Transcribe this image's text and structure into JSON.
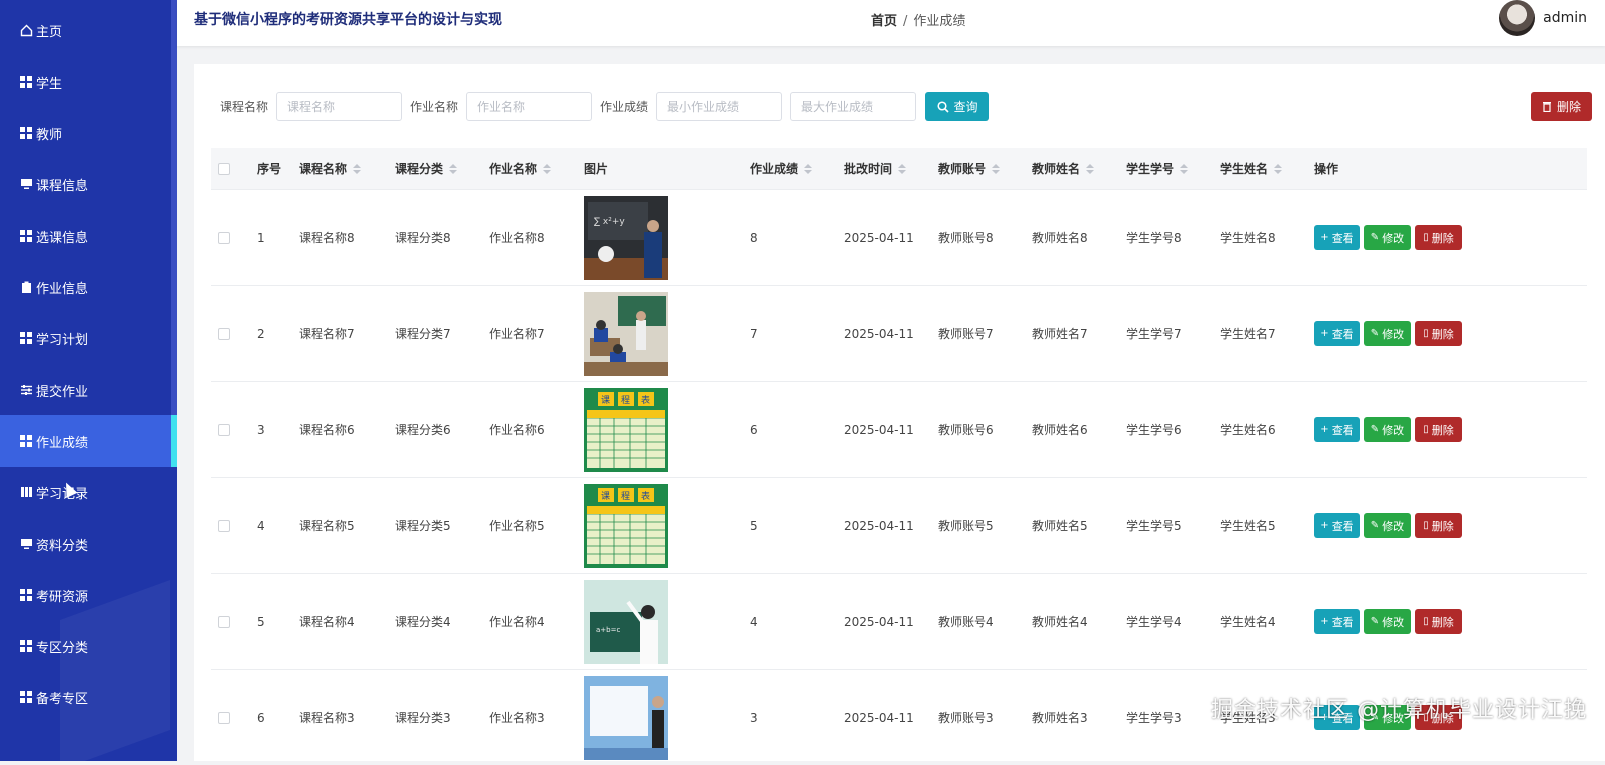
{
  "header": {
    "site_title": "基于微信小程序的考研资源共享平台的设计与实现",
    "breadcrumb_home": "首页",
    "breadcrumb_sep": "/",
    "breadcrumb_current": "作业成绩",
    "username": "admin"
  },
  "sidebar": {
    "items": [
      {
        "label": "主页",
        "icon": "home-icon"
      },
      {
        "label": "学生",
        "icon": "grid-icon"
      },
      {
        "label": "教师",
        "icon": "grid-icon"
      },
      {
        "label": "课程信息",
        "icon": "monitor-icon"
      },
      {
        "label": "选课信息",
        "icon": "grid-icon"
      },
      {
        "label": "作业信息",
        "icon": "clipboard-icon"
      },
      {
        "label": "学习计划",
        "icon": "grid-icon"
      },
      {
        "label": "提交作业",
        "icon": "sliders-icon"
      },
      {
        "label": "作业成绩",
        "icon": "grid-icon",
        "active": true
      },
      {
        "label": "学习记录",
        "icon": "columns-icon"
      },
      {
        "label": "资料分类",
        "icon": "monitor-icon"
      },
      {
        "label": "考研资源",
        "icon": "grid-icon"
      },
      {
        "label": "专区分类",
        "icon": "grid-icon"
      },
      {
        "label": "备考专区",
        "icon": "grid-icon"
      }
    ]
  },
  "search": {
    "course_label": "课程名称",
    "course_placeholder": "课程名称",
    "homework_label": "作业名称",
    "homework_placeholder": "作业名称",
    "score_label": "作业成绩",
    "min_placeholder": "最小作业成绩",
    "max_placeholder": "最大作业成绩",
    "query_label": "查询",
    "delete_label": "删除"
  },
  "table": {
    "columns": [
      "序号",
      "课程名称",
      "课程分类",
      "作业名称",
      "图片",
      "作业成绩",
      "批改时间",
      "教师账号",
      "教师姓名",
      "学生学号",
      "学生姓名",
      "操作"
    ],
    "rows": [
      {
        "idx": "1",
        "course": "课程名称8",
        "category": "课程分类8",
        "homework": "作业名称8",
        "image": "classroom-chalkboard",
        "score": "8",
        "time": "2025-04-11",
        "teacher_no": "教师账号8",
        "teacher_name": "教师姓名8",
        "student_no": "学生学号8",
        "student_name": "学生姓名8"
      },
      {
        "idx": "2",
        "course": "课程名称7",
        "category": "课程分类7",
        "homework": "作业名称7",
        "image": "classroom-students",
        "score": "7",
        "time": "2025-04-11",
        "teacher_no": "教师账号7",
        "teacher_name": "教师姓名7",
        "student_no": "学生学号7",
        "student_name": "学生姓名7"
      },
      {
        "idx": "3",
        "course": "课程名称6",
        "category": "课程分类6",
        "homework": "作业名称6",
        "image": "timetable",
        "score": "6",
        "time": "2025-04-11",
        "teacher_no": "教师账号6",
        "teacher_name": "教师姓名6",
        "student_no": "学生学号6",
        "student_name": "学生姓名6"
      },
      {
        "idx": "4",
        "course": "课程名称5",
        "category": "课程分类5",
        "homework": "作业名称5",
        "image": "timetable",
        "score": "5",
        "time": "2025-04-11",
        "teacher_no": "教师账号5",
        "teacher_name": "教师姓名5",
        "student_no": "学生学号5",
        "student_name": "学生姓名5"
      },
      {
        "idx": "5",
        "course": "课程名称4",
        "category": "课程分类4",
        "homework": "作业名称4",
        "image": "teacher-greenboard",
        "score": "4",
        "time": "2025-04-11",
        "teacher_no": "教师账号4",
        "teacher_name": "教师姓名4",
        "student_no": "学生学号4",
        "student_name": "学生姓名4"
      },
      {
        "idx": "6",
        "course": "课程名称3",
        "category": "课程分类3",
        "homework": "作业名称3",
        "image": "teacher-screen",
        "score": "3",
        "time": "2025-04-11",
        "teacher_no": "教师账号3",
        "teacher_name": "教师姓名3",
        "student_no": "学生学号3",
        "student_name": "学生姓名3"
      }
    ],
    "ops": {
      "view": "查看",
      "edit": "修改",
      "delete": "删除"
    }
  },
  "watermark": "掘金技术社区 @计算机毕业设计江挽",
  "colors": {
    "sidebar": "#1f35a8",
    "active": "#3a62e0",
    "accent": "#3fe0ef",
    "view": "#17a2b8",
    "edit": "#28a745",
    "delete": "#b02a2a"
  }
}
